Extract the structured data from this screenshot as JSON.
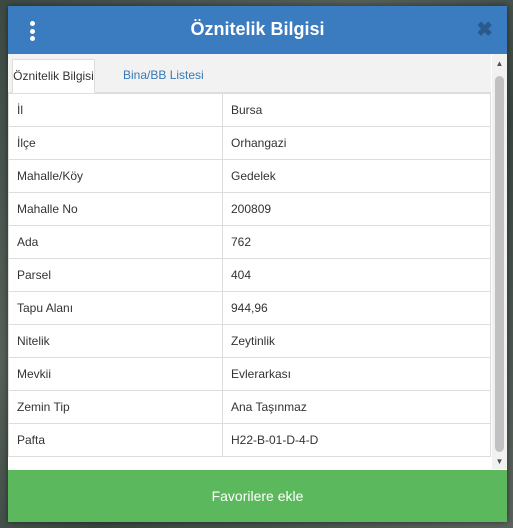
{
  "header": {
    "title": "Öznitelik Bilgisi",
    "menu_icon": "kebab-menu-icon",
    "close_icon": "close-icon",
    "close_glyph": "✖",
    "color": "#3b7bbf"
  },
  "tabs": [
    {
      "label": "Öznitelik Bilgisi",
      "active": true
    },
    {
      "label": "Bina/BB Listesi",
      "active": false
    }
  ],
  "attributes": [
    {
      "key": "İl",
      "value": "Bursa"
    },
    {
      "key": "İlçe",
      "value": "Orhangazi"
    },
    {
      "key": "Mahalle/Köy",
      "value": "Gedelek"
    },
    {
      "key": "Mahalle No",
      "value": "200809"
    },
    {
      "key": "Ada",
      "value": "762"
    },
    {
      "key": "Parsel",
      "value": "404"
    },
    {
      "key": "Tapu Alanı",
      "value": "944,96"
    },
    {
      "key": "Nitelik",
      "value": "Zeytinlik"
    },
    {
      "key": "Mevkii",
      "value": "Evlerarkası"
    },
    {
      "key": "Zemin Tip",
      "value": "Ana Taşınmaz"
    },
    {
      "key": "Pafta",
      "value": "H22-B-01-D-4-D"
    }
  ],
  "footer": {
    "button_label": "Favorilere ekle",
    "color": "#5cb85c"
  }
}
